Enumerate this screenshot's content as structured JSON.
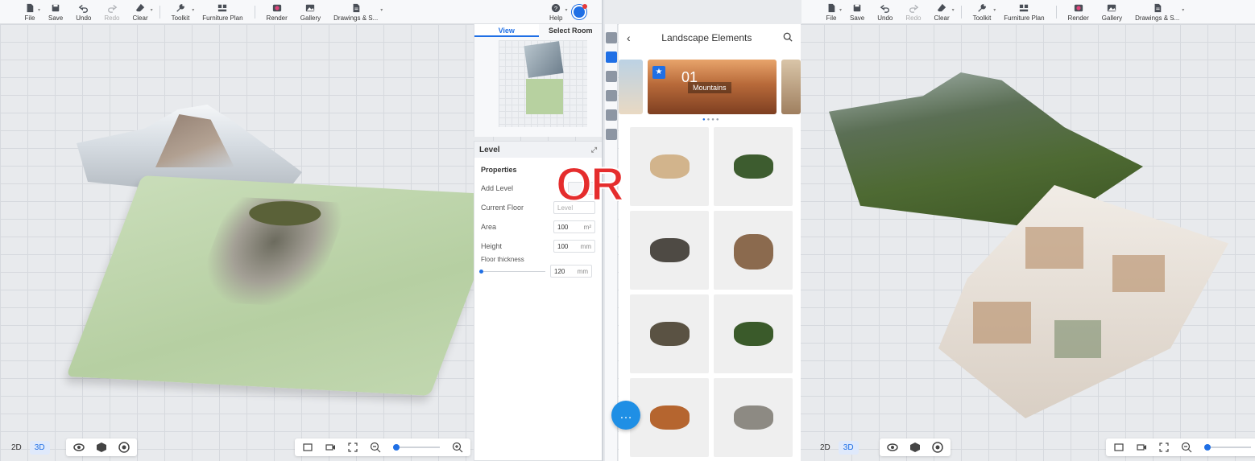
{
  "left": {
    "toolbar": [
      {
        "label": "File",
        "icon": "file-icon",
        "caret": true
      },
      {
        "label": "Save",
        "icon": "save-icon"
      },
      {
        "label": "Undo",
        "icon": "undo-icon"
      },
      {
        "label": "Redo",
        "icon": "redo-icon",
        "disabled": true
      },
      {
        "label": "Clear",
        "icon": "clear-icon",
        "caret": true
      },
      {
        "label": "Toolkit",
        "icon": "toolkit-icon",
        "caret": true
      },
      {
        "label": "Furniture Plan",
        "icon": "furniture-plan-icon"
      },
      {
        "label": "Render",
        "icon": "render-icon"
      },
      {
        "label": "Gallery",
        "icon": "gallery-icon"
      },
      {
        "label": "Drawings & S...",
        "icon": "drawings-icon",
        "caret": true
      }
    ],
    "help_label": "Help",
    "nav_tabs": [
      "View",
      "Select Room"
    ],
    "level_panel": {
      "title": "Level",
      "properties_label": "Properties",
      "add_level_label": "Add Level",
      "current_floor_label": "Current Floor",
      "current_floor_value": "Level",
      "area_label": "Area",
      "area_value": "100",
      "area_unit": "m²",
      "height_label": "Height",
      "height_value": "100",
      "height_unit": "mm",
      "floor_thickness_label": "Floor thickness",
      "floor_thickness_value": "120",
      "floor_thickness_unit": "mm"
    },
    "view_modes": [
      "2D",
      "3D"
    ],
    "active_view": "3D"
  },
  "or_label": "OR",
  "right": {
    "toolbar": [
      {
        "label": "File",
        "icon": "file-icon",
        "caret": true
      },
      {
        "label": "Save",
        "icon": "save-icon"
      },
      {
        "label": "Undo",
        "icon": "undo-icon"
      },
      {
        "label": "Redo",
        "icon": "redo-icon",
        "disabled": true
      },
      {
        "label": "Clear",
        "icon": "clear-icon",
        "caret": true
      },
      {
        "label": "Toolkit",
        "icon": "toolkit-icon",
        "caret": true
      },
      {
        "label": "Furniture Plan",
        "icon": "furniture-plan-icon"
      },
      {
        "label": "Render",
        "icon": "render-icon"
      },
      {
        "label": "Gallery",
        "icon": "gallery-icon"
      },
      {
        "label": "Drawings & S...",
        "icon": "drawings-icon",
        "caret": true
      }
    ],
    "library": {
      "title": "Landscape Elements",
      "banner_number": "01",
      "banner_caption": "Mountains"
    },
    "view_modes": [
      "2D",
      "3D"
    ],
    "active_view": "3D"
  },
  "colors": {
    "accent": "#1f6fe5",
    "or_red": "#e52d2d"
  }
}
